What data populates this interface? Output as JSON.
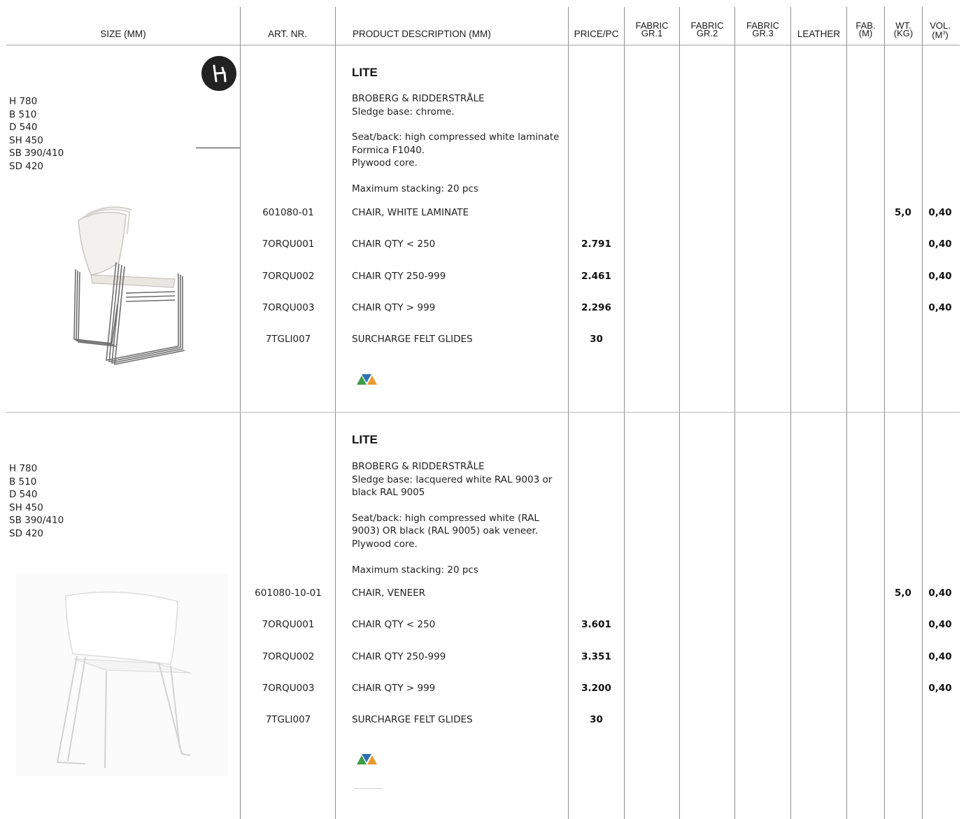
{
  "header": {
    "size": "SIZE (MM)",
    "art_nr": "ART. NR.",
    "description": "PRODUCT DESCRIPTION (MM)",
    "price": "PRICE/PC",
    "fabric1_a": "FABRIC",
    "fabric1_b": "GR.1",
    "fabric2_a": "FABRIC",
    "fabric2_b": "GR.2",
    "fabric3_a": "FABRIC",
    "fabric3_b": "GR.3",
    "leather": "LEATHER",
    "fab_a": "FAB.",
    "fab_b": "(M)",
    "wt_a": "WT.",
    "wt_b": "(KG)",
    "vol_a": "VOL.",
    "vol_b": "(M",
    "vol_sup": "3",
    "vol_c": ")"
  },
  "products": [
    {
      "sizes": [
        "H 780",
        "B 510",
        "D 540",
        "SH 450",
        "SB 390/410",
        "SD 420"
      ],
      "title": "LITE",
      "designer": "BROBERG & RIDDERSTRÅLE",
      "base": "Sledge base: chrome.",
      "seat": "Seat/back: high compressed white laminate Formica F1040.",
      "core": "Plywood core.",
      "stacking": "Maximum stacking: 20 pcs",
      "rows": [
        {
          "art": "601080-01",
          "desc": "CHAIR, WHITE LAMINATE",
          "price": "",
          "wt": "5,0",
          "vol": "0,40"
        },
        {
          "art": "7ORQU001",
          "desc": "CHAIR QTY < 250",
          "price": "2.791",
          "wt": "",
          "vol": "0,40"
        },
        {
          "art": "7ORQU002",
          "desc": "CHAIR QTY 250-999",
          "price": "2.461",
          "wt": "",
          "vol": "0,40"
        },
        {
          "art": "7ORQU003",
          "desc": "CHAIR QTY > 999",
          "price": "2.296",
          "wt": "",
          "vol": "0,40"
        },
        {
          "art": "7TGLI007",
          "desc": "SURCHARGE FELT GLIDES",
          "price": "30",
          "wt": "",
          "vol": ""
        }
      ]
    },
    {
      "sizes": [
        "H 780",
        "B 510",
        "D 540",
        "SH 450",
        "SB 390/410",
        "SD 420"
      ],
      "title": "LITE",
      "designer": "BROBERG & RIDDERSTRÅLE",
      "base": "Sledge base: lacquered white RAL 9003 or black RAL 9005",
      "seat": "Seat/back: high compressed white (RAL 9003) OR black (RAL 9005) oak veneer.",
      "core": "Plywood core.",
      "stacking": "Maximum stacking: 20 pcs",
      "rows": [
        {
          "art": "601080-10-01",
          "desc": "CHAIR, VENEER",
          "price": "",
          "wt": "5,0",
          "vol": "0,40"
        },
        {
          "art": "7ORQU001",
          "desc": "CHAIR QTY < 250",
          "price": "3.601",
          "wt": "",
          "vol": "0,40"
        },
        {
          "art": "7ORQU002",
          "desc": "CHAIR QTY 250-999",
          "price": "3.351",
          "wt": "",
          "vol": "0,40"
        },
        {
          "art": "7ORQU003",
          "desc": "CHAIR QTY > 999",
          "price": "3.200",
          "wt": "",
          "vol": "0,40"
        },
        {
          "art": "7TGLI007",
          "desc": "SURCHARGE FELT GLIDES",
          "price": "30",
          "wt": "",
          "vol": ""
        }
      ]
    }
  ],
  "icons": {
    "badge": "chair-symbol-icon",
    "logo": "triangle-logo-icon",
    "image1": "stacked-chrome-chairs-image",
    "image2": "white-chair-image"
  },
  "colors": {
    "logo_green": "#3f9b48",
    "logo_blue": "#2f6fb4",
    "logo_orange": "#e79a2e"
  }
}
